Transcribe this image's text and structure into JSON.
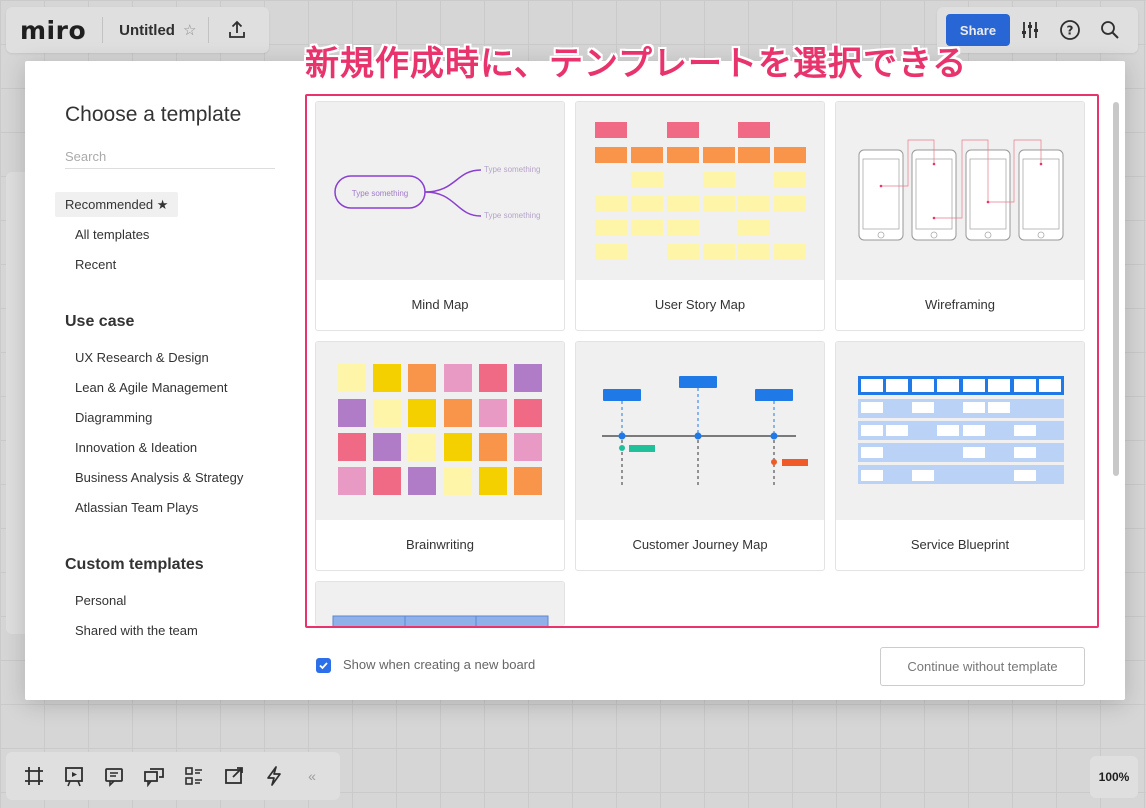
{
  "app": {
    "logo": "miro",
    "board_title": "Untitled",
    "share_label": "Share",
    "zoom": "100%"
  },
  "banner": "新規作成時に、テンプレートを選択できる",
  "modal": {
    "title": "Choose a template",
    "search_placeholder": "Search",
    "nav": {
      "recommended": "Recommended ★",
      "all": "All templates",
      "recent": "Recent"
    },
    "use_case": {
      "heading": "Use case",
      "items": [
        "UX Research & Design",
        "Lean & Agile Management",
        "Diagramming",
        "Innovation & Ideation",
        "Business Analysis & Strategy",
        "Atlassian Team Plays"
      ]
    },
    "custom": {
      "heading": "Custom templates",
      "items": [
        "Personal",
        "Shared with the team"
      ]
    },
    "templates": [
      "Mind Map",
      "User Story Map",
      "Wireframing",
      "Brainwriting",
      "Customer Journey Map",
      "Service Blueprint"
    ],
    "mindmap_preview": {
      "center": "Type something",
      "branch_top": "Type something",
      "branch_bottom": "Type something"
    },
    "footer": {
      "checkbox_label": "Show when creating a new board",
      "continue_label": "Continue without template"
    }
  },
  "colors": {
    "accent": "#2d6fe8",
    "highlight": "#e8336d",
    "mindmap": "#8a3fd1"
  }
}
